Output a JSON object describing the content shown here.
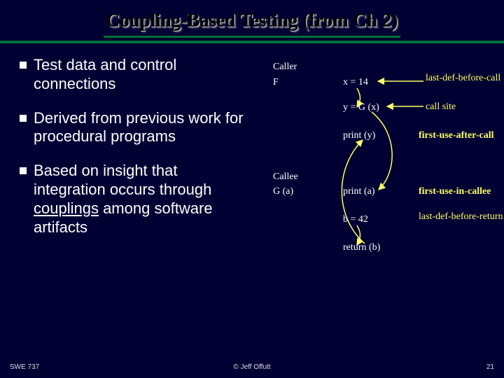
{
  "title": "Coupling-Based Testing (from Ch 2)",
  "bullets": [
    "Test data and control connections",
    "Derived from previous work for procedural programs"
  ],
  "bullet3_prefix": "Based on insight that integration occurs through ",
  "bullet3_underlined": "couplings",
  "bullet3_suffix": " among software artifacts",
  "diagram": {
    "caller_label": "Caller",
    "caller_func": "F",
    "caller_lines": {
      "x": "x = 14",
      "y": "y = G (x)",
      "print": "print (y)"
    },
    "callee_label": "Callee",
    "callee_func": "G (a)",
    "callee_lines": {
      "print": "print (a)",
      "b": "b = 42",
      "ret": "return (b)"
    },
    "annotations": {
      "ldbc": "last-def-before-call",
      "cs": "call site",
      "fuac": "first-use-after-call",
      "fuic": "first-use-in-callee",
      "ldbr": "last-def-before-return"
    }
  },
  "footer": {
    "left": "SWE 737",
    "center": "© Jeff Offutt",
    "right": "21"
  }
}
